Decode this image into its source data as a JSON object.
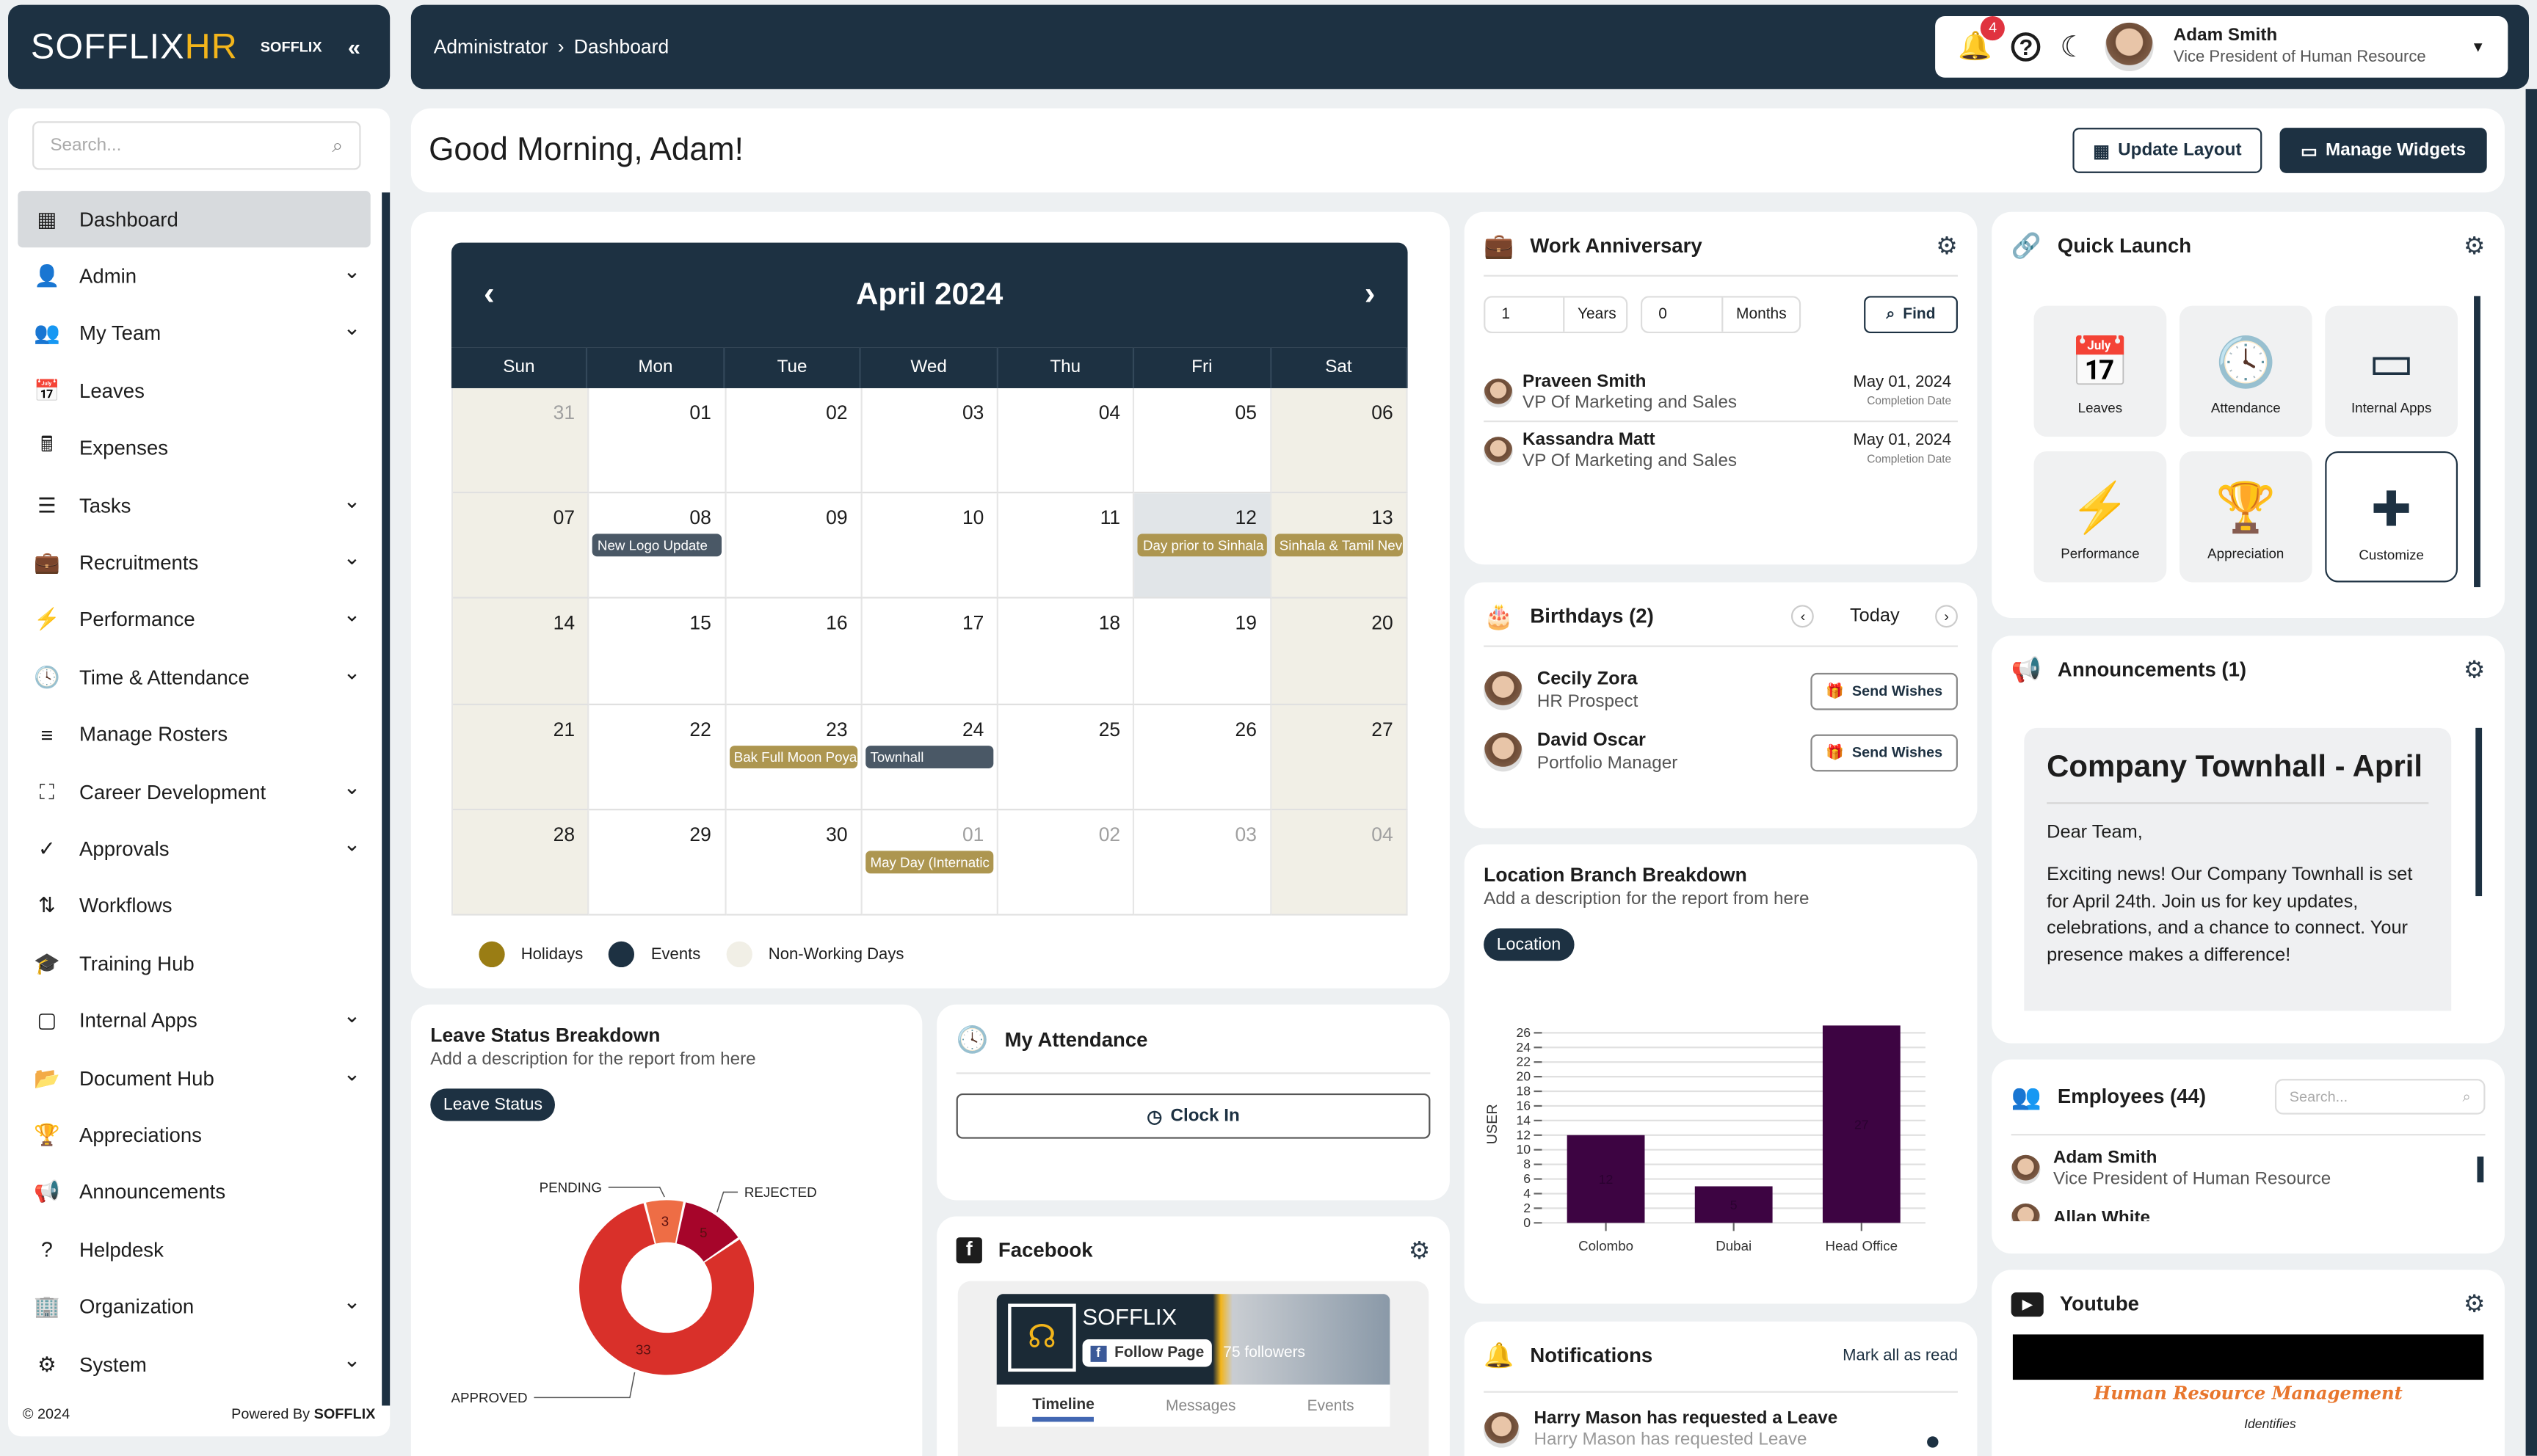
{
  "brand": {
    "logo_text_a": "SOFFLIX",
    "logo_text_b": "HR",
    "org": "SOFFLIX"
  },
  "header": {
    "breadcrumb": [
      "Administrator",
      "Dashboard"
    ],
    "notification_count": "4",
    "user_name": "Adam Smith",
    "user_role": "Vice President of Human Resource"
  },
  "sidebar": {
    "search_placeholder": "Search...",
    "items": [
      {
        "label": "Dashboard",
        "icon": "grid-icon",
        "glyph": "▦",
        "chevron": false,
        "active": true
      },
      {
        "label": "Admin",
        "icon": "user-icon",
        "glyph": "👤",
        "chevron": true
      },
      {
        "label": "My Team",
        "icon": "users-icon",
        "glyph": "👥",
        "chevron": true
      },
      {
        "label": "Leaves",
        "icon": "calendar-icon",
        "glyph": "📅",
        "chevron": false
      },
      {
        "label": "Expenses",
        "icon": "calculator-icon",
        "glyph": "🖩",
        "chevron": false
      },
      {
        "label": "Tasks",
        "icon": "list-icon",
        "glyph": "☰",
        "chevron": true
      },
      {
        "label": "Recruitments",
        "icon": "briefcase-icon",
        "glyph": "💼",
        "chevron": true
      },
      {
        "label": "Performance",
        "icon": "bolt-icon",
        "glyph": "⚡",
        "chevron": true
      },
      {
        "label": "Time & Attendance",
        "icon": "clock-icon",
        "glyph": "🕓",
        "chevron": true
      },
      {
        "label": "Manage Rosters",
        "icon": "bars-icon",
        "glyph": "≡",
        "chevron": false
      },
      {
        "label": "Career Development",
        "icon": "network-icon",
        "glyph": "⛶",
        "chevron": true
      },
      {
        "label": "Approvals",
        "icon": "check-circle-icon",
        "glyph": "✓",
        "chevron": true
      },
      {
        "label": "Workflows",
        "icon": "sort-icon",
        "glyph": "⇅",
        "chevron": false
      },
      {
        "label": "Training Hub",
        "icon": "graduation-cap-icon",
        "glyph": "🎓",
        "chevron": false
      },
      {
        "label": "Internal Apps",
        "icon": "tablet-icon",
        "glyph": "▢",
        "chevron": true
      },
      {
        "label": "Document Hub",
        "icon": "folder-icon",
        "glyph": "📂",
        "chevron": true
      },
      {
        "label": "Appreciations",
        "icon": "trophy-icon",
        "glyph": "🏆",
        "chevron": false
      },
      {
        "label": "Announcements",
        "icon": "megaphone-icon",
        "glyph": "📢",
        "chevron": false
      },
      {
        "label": "Helpdesk",
        "icon": "question-icon",
        "glyph": "?",
        "chevron": false
      },
      {
        "label": "Organization",
        "icon": "building-icon",
        "glyph": "🏢",
        "chevron": true
      },
      {
        "label": "System",
        "icon": "gears-icon",
        "glyph": "⚙",
        "chevron": true
      }
    ],
    "footer_year": "© 2024",
    "powered_by": "Powered By",
    "powered_brand": "SOFFLIX"
  },
  "greeting": {
    "text": "Good Morning, Adam!",
    "update_layout": "Update Layout",
    "manage_widgets": "Manage Widgets"
  },
  "calendar": {
    "month": "April 2024",
    "weekdays": [
      "Sun",
      "Mon",
      "Tue",
      "Wed",
      "Thu",
      "Fri",
      "Sat"
    ],
    "weeks": [
      [
        {
          "d": "31",
          "muted": true
        },
        {
          "d": "01"
        },
        {
          "d": "02"
        },
        {
          "d": "03"
        },
        {
          "d": "04"
        },
        {
          "d": "05"
        },
        {
          "d": "06"
        }
      ],
      [
        {
          "d": "07"
        },
        {
          "d": "08",
          "event": {
            "label": "New Logo Update",
            "type": "event"
          }
        },
        {
          "d": "09"
        },
        {
          "d": "10"
        },
        {
          "d": "11"
        },
        {
          "d": "12",
          "today": true,
          "event": {
            "label": "Day prior to Sinhala",
            "type": "holiday"
          }
        },
        {
          "d": "13",
          "event": {
            "label": "Sinhala & Tamil Nev",
            "type": "holiday"
          }
        }
      ],
      [
        {
          "d": "14"
        },
        {
          "d": "15"
        },
        {
          "d": "16"
        },
        {
          "d": "17"
        },
        {
          "d": "18"
        },
        {
          "d": "19"
        },
        {
          "d": "20"
        }
      ],
      [
        {
          "d": "21"
        },
        {
          "d": "22"
        },
        {
          "d": "23",
          "event": {
            "label": "Bak Full Moon Poya",
            "type": "holiday"
          }
        },
        {
          "d": "24",
          "event": {
            "label": "Townhall",
            "type": "event"
          }
        },
        {
          "d": "25"
        },
        {
          "d": "26"
        },
        {
          "d": "27"
        }
      ],
      [
        {
          "d": "28"
        },
        {
          "d": "29"
        },
        {
          "d": "30"
        },
        {
          "d": "01",
          "muted": true,
          "event": {
            "label": "May Day (Internatic",
            "type": "holiday"
          }
        },
        {
          "d": "02",
          "muted": true
        },
        {
          "d": "03",
          "muted": true
        },
        {
          "d": "04",
          "muted": true
        }
      ]
    ],
    "legend": [
      {
        "label": "Holidays",
        "color": "#9a7d14"
      },
      {
        "label": "Events",
        "color": "#1d3142"
      },
      {
        "label": "Non-Working Days",
        "color": "#f1efe6"
      }
    ]
  },
  "work_anniversary": {
    "title": "Work Anniversary",
    "years_value": "1",
    "years_label": "Years",
    "months_value": "0",
    "months_label": "Months",
    "find": "Find",
    "people": [
      {
        "name": "Praveen Smith",
        "role": "VP Of Marketing and Sales",
        "date": "May 01, 2024",
        "date_label": "Completion Date"
      },
      {
        "name": "Kassandra Matt",
        "role": "VP Of Marketing and Sales",
        "date": "May 01, 2024",
        "date_label": "Completion Date"
      }
    ]
  },
  "birthdays": {
    "title": "Birthdays (2)",
    "period": "Today",
    "send": "Send Wishes",
    "people": [
      {
        "name": "Cecily Zora",
        "role": "HR Prospect"
      },
      {
        "name": "David Oscar",
        "role": "Portfolio Manager"
      }
    ]
  },
  "location": {
    "title": "Location Branch Breakdown",
    "desc": "Add a description for the report from here",
    "pill": "Location"
  },
  "leave_status": {
    "title": "Leave Status Breakdown",
    "desc": "Add a description for the report from here",
    "pill": "Leave Status"
  },
  "attendance": {
    "title": "My Attendance",
    "clock_in": "Clock In"
  },
  "facebook": {
    "title": "Facebook",
    "page_name": "SOFFLIX",
    "follow": "Follow Page",
    "followers": "75 followers",
    "tabs": [
      "Timeline",
      "Messages",
      "Events"
    ]
  },
  "notifications": {
    "title": "Notifications",
    "mark_all": "Mark all as read",
    "items": [
      {
        "title": "Harry Mason has requested a Leave",
        "body": "Harry Mason has requested Leave"
      }
    ]
  },
  "quick_launch": {
    "title": "Quick Launch",
    "items": [
      {
        "label": "Leaves",
        "icon": "calendar-icon",
        "glyph": "📅"
      },
      {
        "label": "Attendance",
        "icon": "clock-icon",
        "glyph": "🕓"
      },
      {
        "label": "Internal Apps",
        "icon": "tablet-icon",
        "glyph": "▭"
      },
      {
        "label": "Performance",
        "icon": "bolt-icon",
        "glyph": "⚡"
      },
      {
        "label": "Appreciation",
        "icon": "trophy-icon",
        "glyph": "🏆"
      },
      {
        "label": "Customize",
        "icon": "plus-icon",
        "glyph": "✚"
      }
    ]
  },
  "announcements": {
    "title": "Announcements (1)",
    "heading": "Company Townhall - April",
    "greeting": "Dear Team,",
    "body": "Exciting news! Our Company Townhall is set for April 24th. Join us for key updates, celebrations, and a chance to connect. Your presence makes a difference!"
  },
  "employees": {
    "title": "Employees (44)",
    "search_placeholder": "Search...",
    "items": [
      {
        "name": "Adam Smith",
        "role": "Vice President of Human Resource"
      },
      {
        "name": "Allan White",
        "role": ""
      }
    ]
  },
  "youtube": {
    "title": "Youtube",
    "video_title": "Human Resource Management",
    "video_text": "Identifies"
  },
  "chart_data": [
    {
      "type": "bar",
      "categories": [
        "Colombo",
        "Dubai",
        "Head Office"
      ],
      "values": [
        12,
        5,
        27
      ],
      "ylabel": "USER",
      "yticks": [
        0,
        2,
        4,
        6,
        8,
        10,
        12,
        14,
        16,
        18,
        20,
        22,
        24,
        26
      ],
      "ylim": [
        0,
        27
      ],
      "grid": true,
      "color": "#3d0442"
    },
    {
      "type": "pie",
      "donut": true,
      "categories": [
        "APPROVED",
        "PENDING",
        "REJECTED"
      ],
      "values": [
        33,
        3,
        5
      ],
      "colors": [
        "#d9302a",
        "#ee6d45",
        "#a6052a"
      ]
    }
  ]
}
